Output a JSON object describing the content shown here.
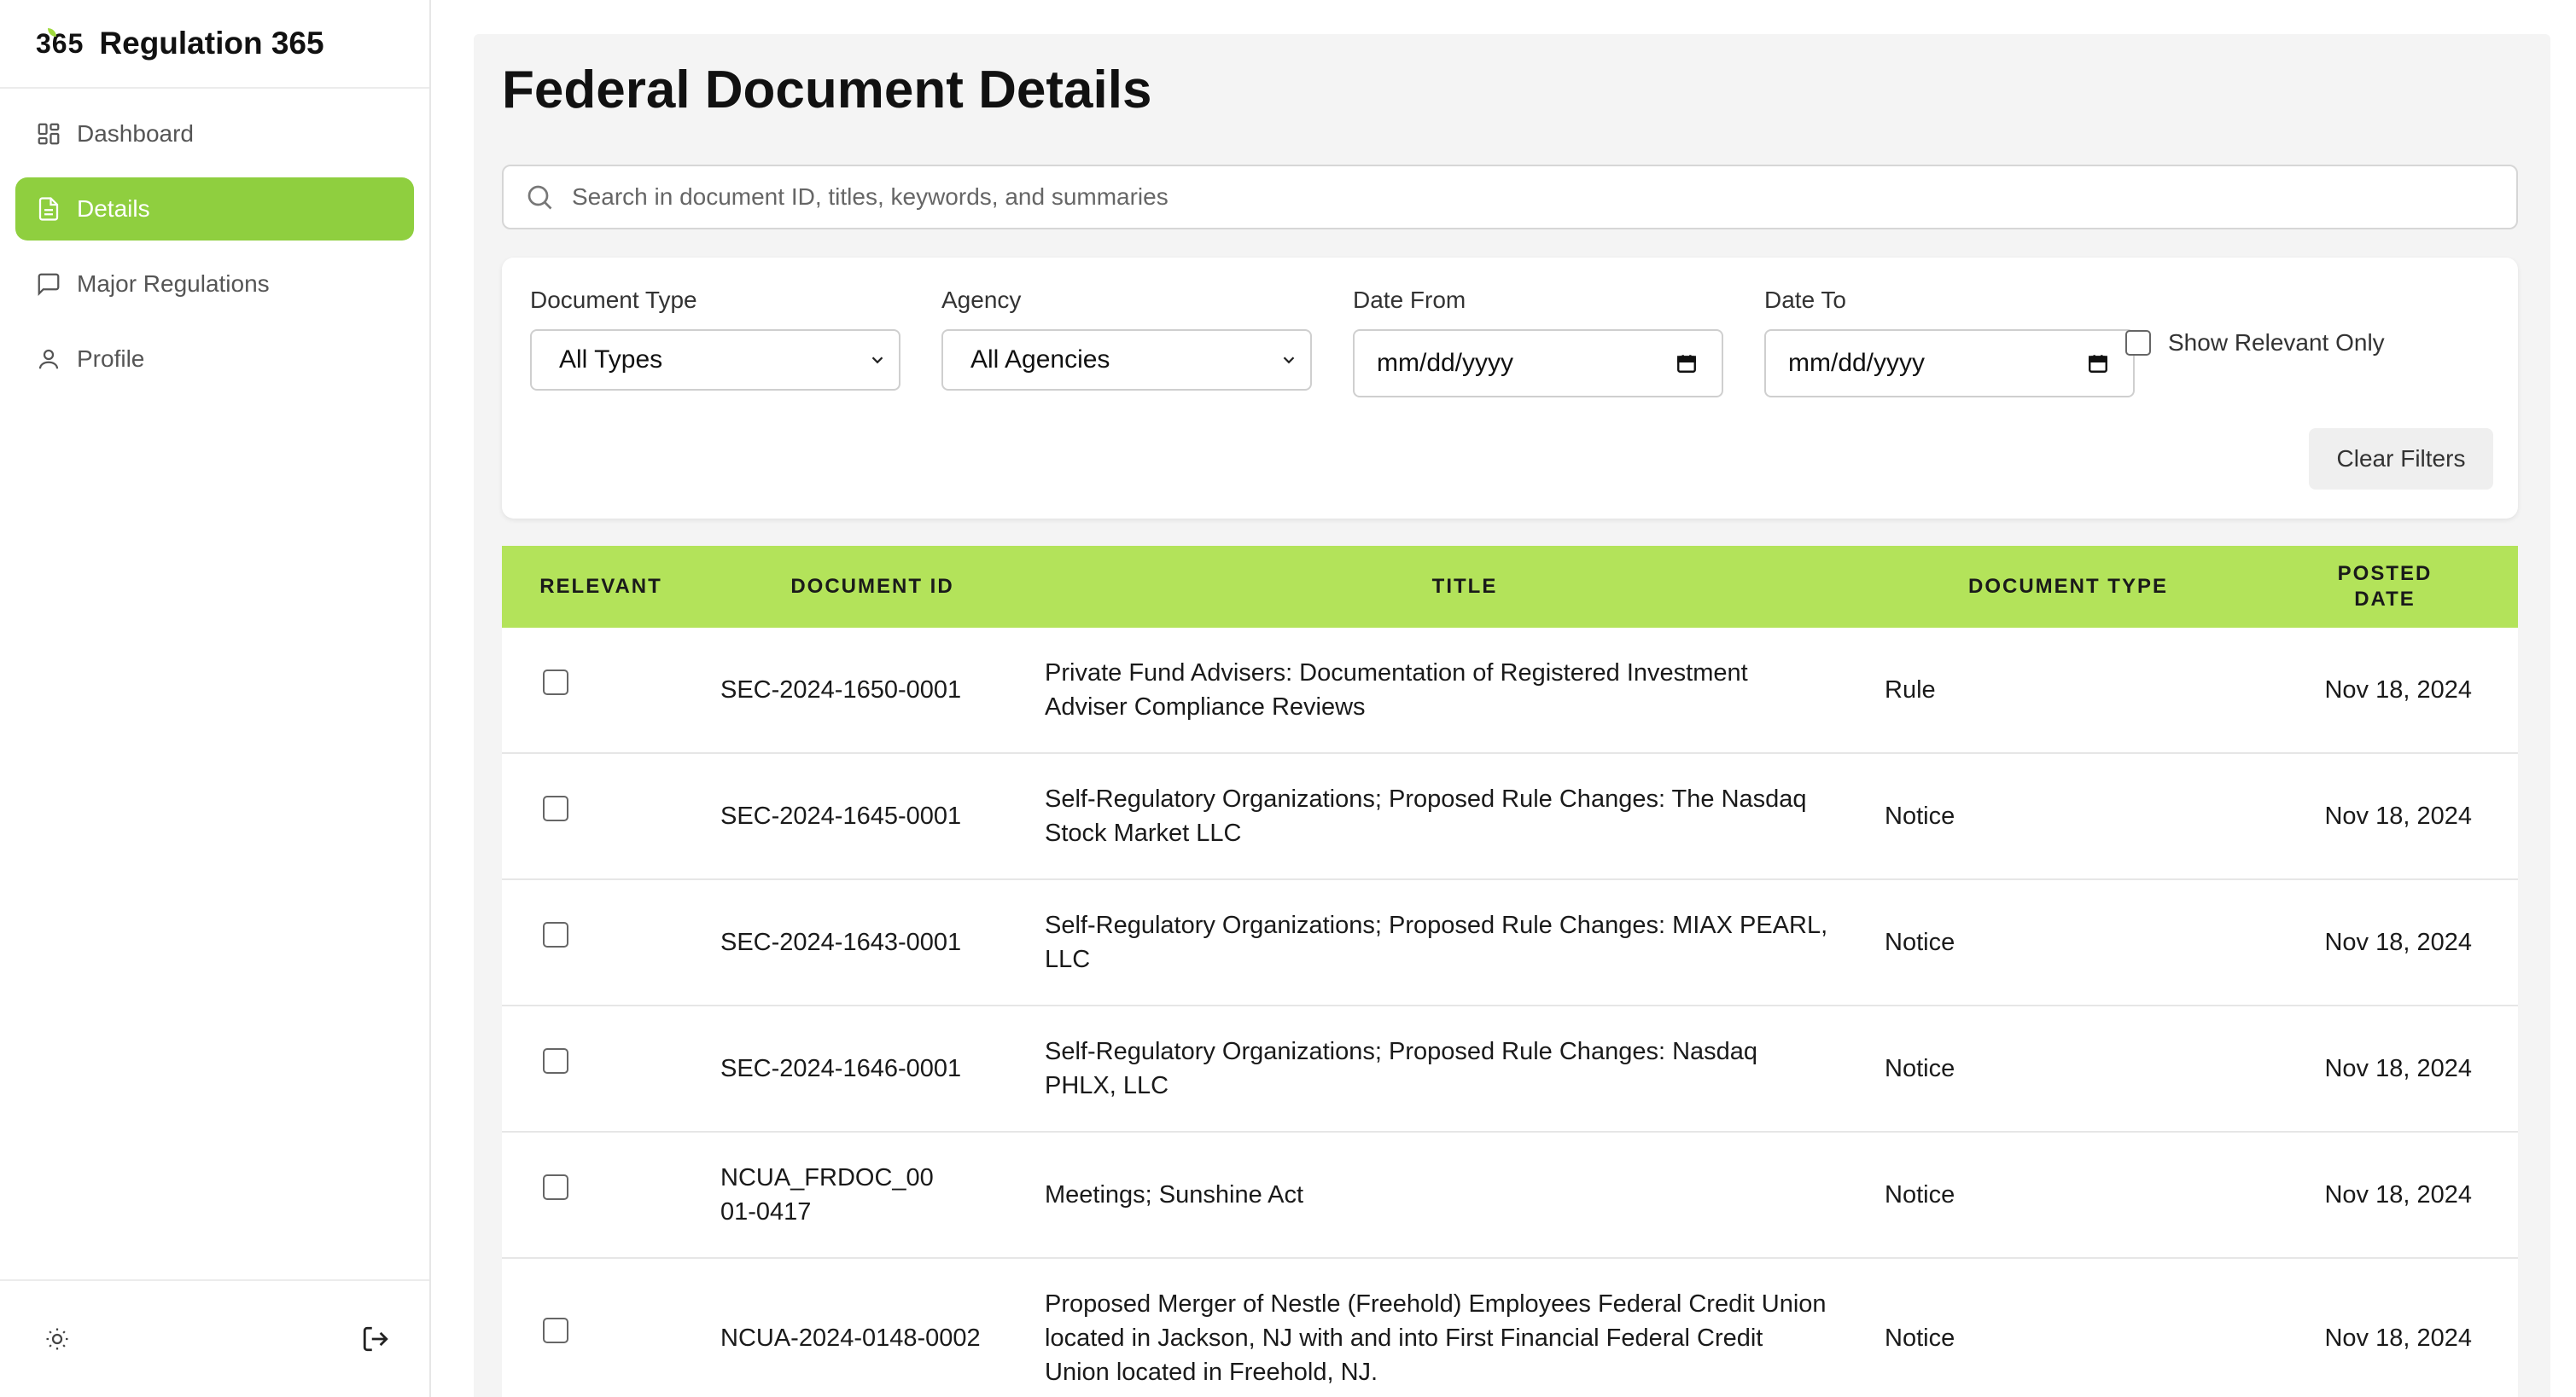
{
  "brand": {
    "logo_text": "365",
    "name": "Regulation 365"
  },
  "sidebar": {
    "items": [
      {
        "label": "Dashboard",
        "icon": "dashboard-icon",
        "active": false
      },
      {
        "label": "Details",
        "icon": "document-icon",
        "active": true
      },
      {
        "label": "Major Regulations",
        "icon": "message-icon",
        "active": false
      },
      {
        "label": "Profile",
        "icon": "user-icon",
        "active": false
      }
    ],
    "footer": {
      "theme_icon": "sun-icon",
      "logout_icon": "logout-icon"
    }
  },
  "page": {
    "title": "Federal Document Details"
  },
  "search": {
    "placeholder": "Search in document ID, titles, keywords, and summaries",
    "value": ""
  },
  "filters": {
    "document_type": {
      "label": "Document Type",
      "value": "All Types"
    },
    "agency": {
      "label": "Agency",
      "value": "All Agencies"
    },
    "date_from": {
      "label": "Date From",
      "value": "mm/dd/yyyy"
    },
    "date_to": {
      "label": "Date To",
      "value": "mm/dd/yyyy"
    },
    "show_relevant_only": {
      "label": "Show Relevant Only",
      "checked": false
    },
    "clear_label": "Clear Filters"
  },
  "table": {
    "headers": {
      "relevant": "RELEVANT",
      "document_id": "DOCUMENT ID",
      "title": "TITLE",
      "document_type": "DOCUMENT TYPE",
      "posted_date": "POSTED DATE"
    },
    "rows": [
      {
        "id": "SEC-2024-1650-0001",
        "title": "Private Fund Advisers: Documentation of Registered Investment Adviser Compliance Reviews",
        "type": "Rule",
        "date": "Nov 18, 2024",
        "relevant": false
      },
      {
        "id": "SEC-2024-1645-0001",
        "title": "Self-Regulatory Organizations; Proposed Rule Changes: The Nasdaq Stock Market LLC",
        "type": "Notice",
        "date": "Nov 18, 2024",
        "relevant": false
      },
      {
        "id": "SEC-2024-1643-0001",
        "title": "Self-Regulatory Organizations; Proposed Rule Changes: MIAX PEARL, LLC",
        "type": "Notice",
        "date": "Nov 18, 2024",
        "relevant": false
      },
      {
        "id": "SEC-2024-1646-0001",
        "title": "Self-Regulatory Organizations; Proposed Rule Changes: Nasdaq PHLX, LLC",
        "type": "Notice",
        "date": "Nov 18, 2024",
        "relevant": false
      },
      {
        "id": "NCUA_FRDOC_0001-0417",
        "title": "Meetings; Sunshine Act",
        "type": "Notice",
        "date": "Nov 18, 2024",
        "relevant": false
      },
      {
        "id": "NCUA-2024-0148-0002",
        "title": "Proposed Merger of Nestle (Freehold) Employees Federal Credit Union located in Jackson, NJ with and into First Financial Federal Credit Union located in Freehold, NJ.",
        "type": "Notice",
        "date": "Nov 18, 2024",
        "relevant": false
      }
    ]
  },
  "colors": {
    "accent": "#8fcf3f",
    "table_header": "#b3e35a",
    "background": "#f4f4f4"
  }
}
